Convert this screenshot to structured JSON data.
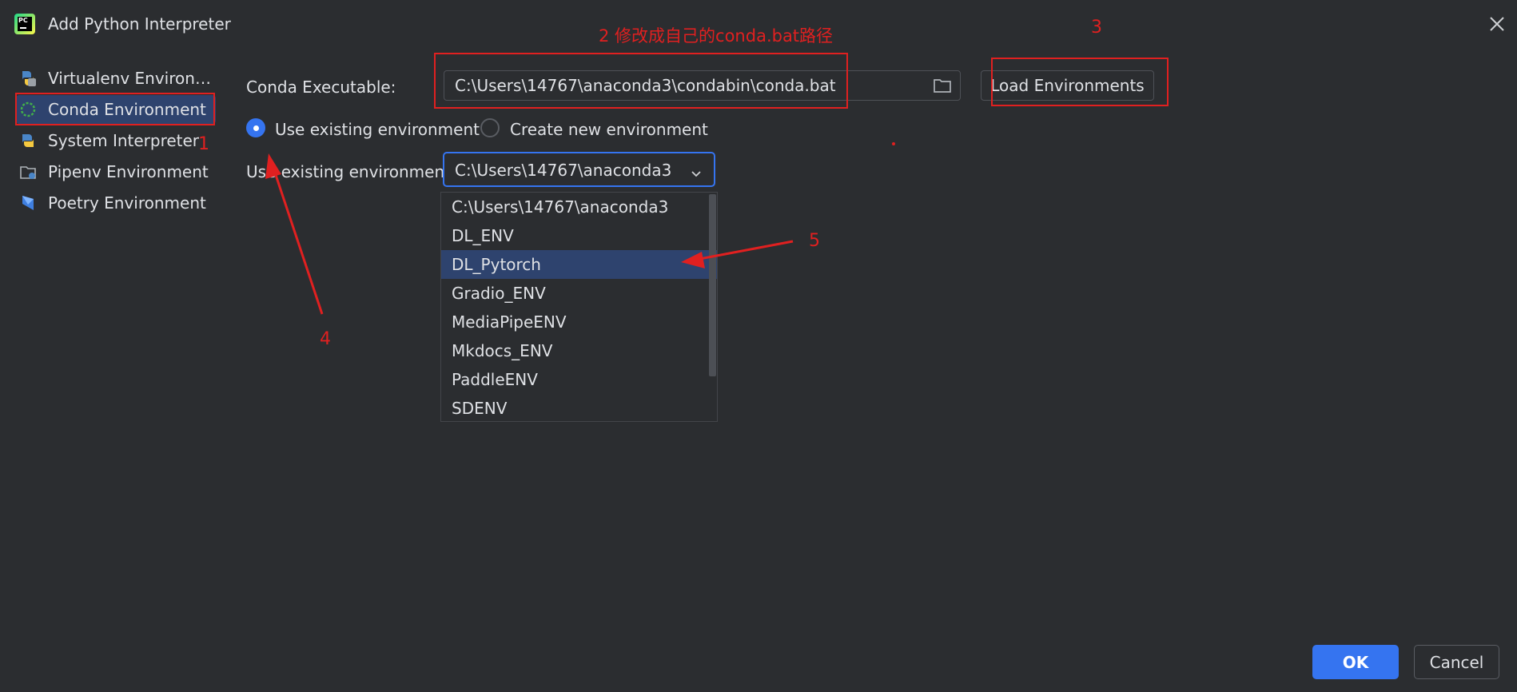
{
  "window": {
    "title": "Add Python Interpreter",
    "logo_text": "PC",
    "icons": {
      "logo": "pycharm-logo",
      "close": "close-icon"
    }
  },
  "sidebar": {
    "items": [
      {
        "label": "Virtualenv Environme...",
        "icon": "virtualenv-icon",
        "selected": false
      },
      {
        "label": "Conda Environment",
        "icon": "conda-icon",
        "selected": true
      },
      {
        "label": "System Interpreter",
        "icon": "python-icon",
        "selected": false
      },
      {
        "label": "Pipenv Environment",
        "icon": "pipenv-icon",
        "selected": false
      },
      {
        "label": "Poetry Environment",
        "icon": "poetry-icon",
        "selected": false
      }
    ]
  },
  "form": {
    "conda_label": "Conda Executable:",
    "conda_path": "C:\\Users\\14767\\anaconda3\\condabin\\conda.bat",
    "load_button": "Load Environments",
    "radio_existing": "Use existing environment",
    "radio_new": "Create new environment",
    "radio_selected": "existing",
    "env_label": "Use existing environment:",
    "env_selected": "C:\\Users\\14767\\anaconda3",
    "env_options": [
      "C:\\Users\\14767\\anaconda3",
      "DL_ENV",
      "DL_Pytorch",
      "Gradio_ENV",
      "MediaPipeENV",
      "Mkdocs_ENV",
      "PaddleENV",
      "SDENV"
    ],
    "env_highlighted": "DL_Pytorch"
  },
  "footer": {
    "ok": "OK",
    "cancel": "Cancel"
  },
  "annotations": {
    "n1": "1",
    "text2": "2 修改成自己的conda.bat路径",
    "n3": "3",
    "n4": "4",
    "n5": "5",
    "color": "#e02020"
  },
  "colors": {
    "accent": "#3574f0",
    "background": "#2b2d30",
    "selection": "#2e436e"
  }
}
